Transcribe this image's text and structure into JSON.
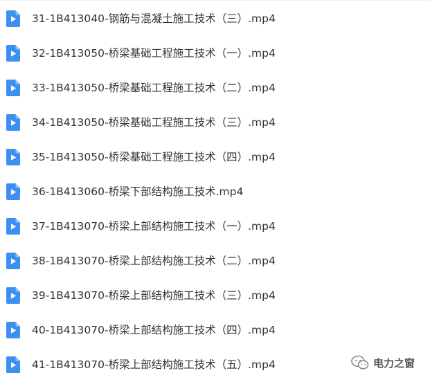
{
  "files": [
    {
      "name": "31-1B413040-钢筋与混凝土施工技术（三）.mp4",
      "icon": "video-file-icon"
    },
    {
      "name": "32-1B413050-桥梁基础工程施工技术（一）.mp4",
      "icon": "video-file-icon"
    },
    {
      "name": "33-1B413050-桥梁基础工程施工技术（二）.mp4",
      "icon": "video-file-icon"
    },
    {
      "name": "34-1B413050-桥梁基础工程施工技术（三）.mp4",
      "icon": "video-file-icon"
    },
    {
      "name": "35-1B413050-桥梁基础工程施工技术（四）.mp4",
      "icon": "video-file-icon"
    },
    {
      "name": "36-1B413060-桥梁下部结构施工技术.mp4",
      "icon": "video-file-icon"
    },
    {
      "name": "37-1B413070-桥梁上部结构施工技术（一）.mp4",
      "icon": "video-file-icon"
    },
    {
      "name": "38-1B413070-桥梁上部结构施工技术（二）.mp4",
      "icon": "video-file-icon"
    },
    {
      "name": "39-1B413070-桥梁上部结构施工技术（三）.mp4",
      "icon": "video-file-icon"
    },
    {
      "name": "40-1B413070-桥梁上部结构施工技术（四）.mp4",
      "icon": "video-file-icon"
    },
    {
      "name": "41-1B413070-桥梁上部结构施工技术（五）.mp4",
      "icon": "video-file-icon"
    }
  ],
  "watermark": {
    "text": "电力之窗",
    "icon": "wechat-official-account-icon"
  },
  "colors": {
    "icon_blue": "#3d8ff2",
    "icon_fold": "#8ec0fa",
    "text": "#333333"
  }
}
